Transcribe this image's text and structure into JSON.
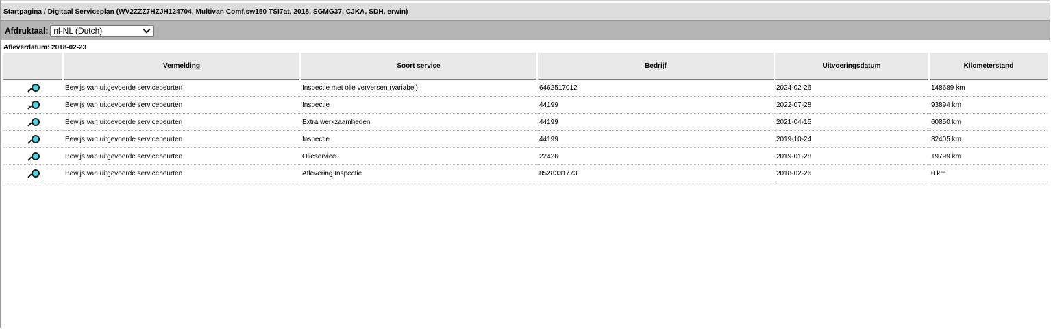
{
  "breadcrumb": "Startpagina / Digitaal Serviceplan (WV2ZZZ7HZJH124704, Multivan Comf.sw150 TSI7at, 2018, SGMG37, CJKA, SDH, erwin)",
  "language": {
    "label": "Afdruktaal:",
    "selected": "nl-NL (Dutch)"
  },
  "delivery_date": "Afleverdatum: 2018-02-23",
  "table": {
    "columns": [
      "",
      "Vermelding",
      "Soort service",
      "Bedrijf",
      "Uitvoeringsdatum",
      "Kilometerstand"
    ],
    "rows": [
      {
        "icon": "magnifier-icon",
        "vermelding": "Bewijs van uitgevoerde servicebeurten",
        "soort": "Inspectie met olie verversen (variabel)",
        "bedrijf": "6462517012",
        "datum": "2024-02-26",
        "km": "148689 km"
      },
      {
        "icon": "magnifier-icon",
        "vermelding": "Bewijs van uitgevoerde servicebeurten",
        "soort": "Inspectie",
        "bedrijf": "44199",
        "datum": "2022-07-28",
        "km": "93894 km"
      },
      {
        "icon": "magnifier-icon",
        "vermelding": "Bewijs van uitgevoerde servicebeurten",
        "soort": "Extra werkzaamheden",
        "bedrijf": "44199",
        "datum": "2021-04-15",
        "km": "60850 km"
      },
      {
        "icon": "magnifier-icon",
        "vermelding": "Bewijs van uitgevoerde servicebeurten",
        "soort": "Inspectie",
        "bedrijf": "44199",
        "datum": "2019-10-24",
        "km": "32405 km"
      },
      {
        "icon": "magnifier-icon",
        "vermelding": "Bewijs van uitgevoerde servicebeurten",
        "soort": "Olieservice",
        "bedrijf": "22426",
        "datum": "2019-01-28",
        "km": "19799 km"
      },
      {
        "icon": "magnifier-icon",
        "vermelding": "Bewijs van uitgevoerde servicebeurten",
        "soort": "Aflevering Inspectie",
        "bedrijf": "8528331773",
        "datum": "2018-02-26",
        "km": "0 km"
      }
    ]
  },
  "colors": {
    "header_bg": "#dcdcdc",
    "toolbar_bg": "#b4b4b4",
    "table_header_bg": "#e8e8e8",
    "icon_lens": "#48d8e8"
  }
}
